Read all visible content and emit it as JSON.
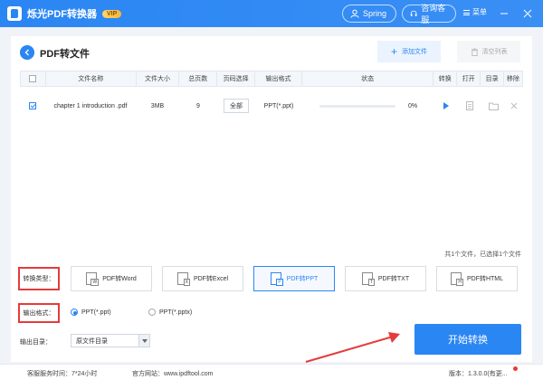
{
  "titlebar": {
    "app_title": "烁光PDF转换器",
    "vip_badge": "VIP",
    "user_name": "Spring",
    "support_label": "咨询客服",
    "menu_label": "菜单"
  },
  "page": {
    "title": "PDF转文件",
    "add_file_label": "添加文件",
    "clear_list_label": "清空列表"
  },
  "table": {
    "headers": {
      "name": "文件名称",
      "size": "文件大小",
      "pages": "总页数",
      "range": "页码选择",
      "format": "输出格式",
      "status": "状态",
      "convert": "转换",
      "open": "打开",
      "dir": "目录",
      "remove": "移除"
    },
    "rows": [
      {
        "name": "chapter 1  introduction .pdf",
        "size": "3MB",
        "pages": "9",
        "range": "全部",
        "format": "PPT(*.ppt)",
        "progress_fraction": 0,
        "progress_text": "0%"
      }
    ],
    "summary": "共1个文件，已选择1个文件"
  },
  "conversion": {
    "type_label": "转换类型：",
    "types": [
      "PDF转Word",
      "PDF转Excel",
      "PDF转PPT",
      "PDF转TXT",
      "PDF转HTML"
    ],
    "type_icon_letters": [
      "W",
      "X",
      "P",
      "T",
      "H"
    ],
    "active_type": "PDF转PPT",
    "format_label": "输出格式：",
    "formats": [
      "PPT(*.ppt)",
      "PPT(*.pptx)"
    ],
    "selected_format": "PPT(*.ppt)",
    "output_dir_label": "输出目录：",
    "output_dir_value": "原文件目录",
    "start_button": "开始转换"
  },
  "footer": {
    "service_hours": "客服服务时间：7*24小时",
    "website": "官方网站：www.ipdftool.com",
    "version": "版本：1.3.0.0(有更..."
  },
  "colors": {
    "accent": "#2a86f3",
    "highlight_box": "#e53b3b"
  }
}
